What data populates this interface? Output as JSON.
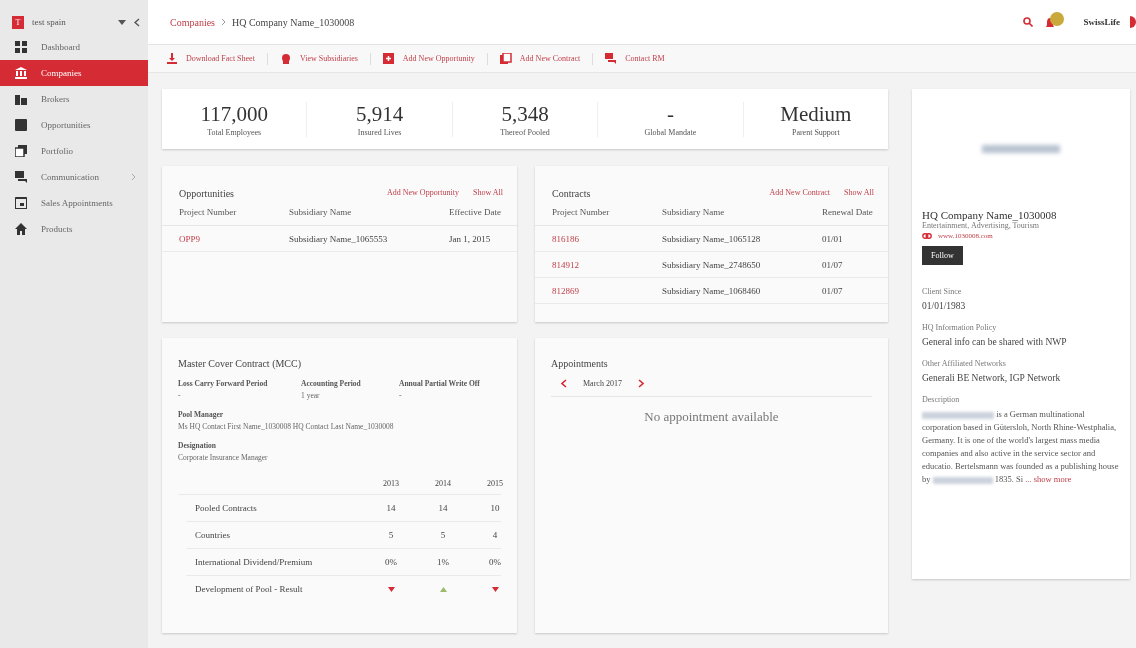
{
  "sidebar": {
    "account": {
      "badge": "T",
      "name": "test spain"
    },
    "items": [
      {
        "label": "Dashboard",
        "selected": false,
        "expandable": false
      },
      {
        "label": "Companies",
        "selected": true,
        "expandable": false
      },
      {
        "label": "Brokers",
        "selected": false,
        "expandable": false
      },
      {
        "label": "Opportunities",
        "selected": false,
        "expandable": false
      },
      {
        "label": "Portfolio",
        "selected": false,
        "expandable": false
      },
      {
        "label": "Communication",
        "selected": false,
        "expandable": true
      },
      {
        "label": "Sales Appointments",
        "selected": false,
        "expandable": false
      },
      {
        "label": "Products",
        "selected": false,
        "expandable": false
      }
    ]
  },
  "header": {
    "breadcrumb": [
      {
        "label": "Companies",
        "link": true
      },
      {
        "label": "HQ Company Name_1030008",
        "link": false
      }
    ],
    "brand": "SwissLife"
  },
  "actions": [
    "Download Fact Sheet",
    "View Subsidiaries",
    "Add New Opportunity",
    "Add New Contract",
    "Contact RM"
  ],
  "stats": [
    {
      "value": "117,000",
      "label": "Total Employees"
    },
    {
      "value": "5,914",
      "label": "Insured Lives"
    },
    {
      "value": "5,348",
      "label": "Thereof Pooled"
    },
    {
      "value": "-",
      "label": "Global Mandate"
    },
    {
      "value": "Medium",
      "label": "Parent Support"
    }
  ],
  "opportunities": {
    "title": "Opportunities",
    "links": [
      "Add New Opportunity",
      "Show All"
    ],
    "columns": [
      "Project Number",
      "Subsidiary Name",
      "Effective Date"
    ],
    "rows": [
      [
        "OPP9",
        "Subsidiary Name_1065553",
        "Jan 1, 2015"
      ]
    ]
  },
  "contracts": {
    "title": "Contracts",
    "links": [
      "Add New Contract",
      "Show All"
    ],
    "columns": [
      "Project Number",
      "Subsidiary Name",
      "Renewal Date"
    ],
    "rows": [
      [
        "816186",
        "Subsidiary Name_1065128",
        "01/01"
      ],
      [
        "814912",
        "Subsidiary Name_2748650",
        "01/07"
      ],
      [
        "812869",
        "Subsidiary Name_1068460",
        "01/07"
      ]
    ]
  },
  "mcc": {
    "title": "Master Cover Contract (MCC)",
    "fields": [
      {
        "label": "Loss Carry Forward Period",
        "value": "-"
      },
      {
        "label": "Accounting Period",
        "value": "1 year"
      },
      {
        "label": "Annual Partial Write Off",
        "value": "-"
      }
    ],
    "details": [
      {
        "label": "Pool Manager",
        "value": "Ms HQ Contact First Name_1030008 HQ Contact Last Name_1030008"
      },
      {
        "label": "Designation",
        "value": "Corporate Insurance Manager"
      }
    ],
    "years": [
      "2013",
      "2014",
      "2015"
    ],
    "rows": [
      {
        "kind": "text",
        "label": "Pooled Contracts",
        "cells": [
          "14",
          "14",
          "10"
        ]
      },
      {
        "kind": "text",
        "label": "Countries",
        "cells": [
          "5",
          "5",
          "4"
        ]
      },
      {
        "kind": "text",
        "label": "International Dividend/Premium",
        "cells": [
          "0%",
          "1%",
          "0%"
        ]
      },
      {
        "kind": "trend",
        "label": "Development of Pool - Result",
        "rising": [
          false,
          true,
          false
        ]
      }
    ]
  },
  "appointments": {
    "title": "Appointments",
    "month": "March 2017",
    "empty": "No appointment available"
  },
  "profile": {
    "name": "HQ Company Name_1030008",
    "industries": "Entertainment, Advertising, Tourism",
    "website": "www.1030008.com",
    "follow": "Follow",
    "sections": [
      {
        "label": "Client Since",
        "value": "01/01/1983"
      },
      {
        "label": "HQ Information Policy",
        "value": "General info can be shared with NWP"
      },
      {
        "label": "Other Affiliated Networks",
        "value": "Generali BE Network, IGP Network"
      }
    ],
    "description": {
      "label": "Description",
      "segments": [
        {
          "kind": "redacted"
        },
        {
          "kind": "text",
          "text": " is a German multinational corporation based in Gütersloh, North Rhine-Westphalia, Germany. It is one of the world's largest mass media companies and also active in the service sector and educatio. Bertelsmann was founded as a publishing house by "
        },
        {
          "kind": "redacted"
        },
        {
          "kind": "text",
          "text": " 1835. Si "
        },
        {
          "kind": "link",
          "text": "... show more"
        }
      ]
    }
  }
}
